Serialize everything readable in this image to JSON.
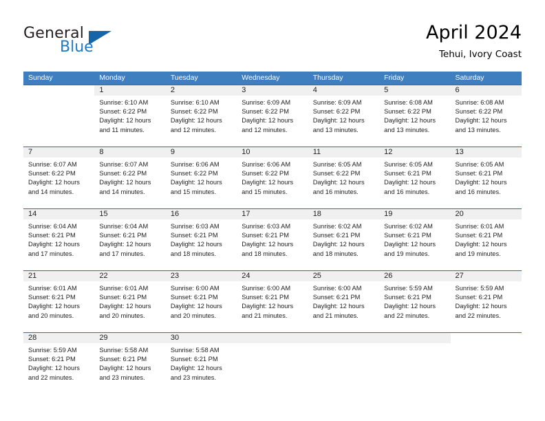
{
  "logo": {
    "word_top": "General",
    "word_bottom": "Blue",
    "triangle_color": "#1565a8",
    "blue_color": "#1f7ac4"
  },
  "header": {
    "title": "April 2024",
    "subtitle": "Tehui, Ivory Coast"
  },
  "theme": {
    "header_row_bg": "#3f7fbf",
    "row_divider": "#2e6da4",
    "day_band_bg": "#f0f0f0"
  },
  "weekdays": [
    "Sunday",
    "Monday",
    "Tuesday",
    "Wednesday",
    "Thursday",
    "Friday",
    "Saturday"
  ],
  "weeks": [
    {
      "days": [
        {
          "number": "",
          "sunrise": "",
          "sunset": "",
          "daylight_1": "",
          "daylight_2": "",
          "state": "blank"
        },
        {
          "number": "1",
          "sunrise": "Sunrise: 6:10 AM",
          "sunset": "Sunset: 6:22 PM",
          "daylight_1": "Daylight: 12 hours",
          "daylight_2": "and 11 minutes.",
          "state": "filled"
        },
        {
          "number": "2",
          "sunrise": "Sunrise: 6:10 AM",
          "sunset": "Sunset: 6:22 PM",
          "daylight_1": "Daylight: 12 hours",
          "daylight_2": "and 12 minutes.",
          "state": "filled"
        },
        {
          "number": "3",
          "sunrise": "Sunrise: 6:09 AM",
          "sunset": "Sunset: 6:22 PM",
          "daylight_1": "Daylight: 12 hours",
          "daylight_2": "and 12 minutes.",
          "state": "filled"
        },
        {
          "number": "4",
          "sunrise": "Sunrise: 6:09 AM",
          "sunset": "Sunset: 6:22 PM",
          "daylight_1": "Daylight: 12 hours",
          "daylight_2": "and 13 minutes.",
          "state": "filled"
        },
        {
          "number": "5",
          "sunrise": "Sunrise: 6:08 AM",
          "sunset": "Sunset: 6:22 PM",
          "daylight_1": "Daylight: 12 hours",
          "daylight_2": "and 13 minutes.",
          "state": "filled"
        },
        {
          "number": "6",
          "sunrise": "Sunrise: 6:08 AM",
          "sunset": "Sunset: 6:22 PM",
          "daylight_1": "Daylight: 12 hours",
          "daylight_2": "and 13 minutes.",
          "state": "filled"
        }
      ]
    },
    {
      "days": [
        {
          "number": "7",
          "sunrise": "Sunrise: 6:07 AM",
          "sunset": "Sunset: 6:22 PM",
          "daylight_1": "Daylight: 12 hours",
          "daylight_2": "and 14 minutes.",
          "state": "filled"
        },
        {
          "number": "8",
          "sunrise": "Sunrise: 6:07 AM",
          "sunset": "Sunset: 6:22 PM",
          "daylight_1": "Daylight: 12 hours",
          "daylight_2": "and 14 minutes.",
          "state": "filled"
        },
        {
          "number": "9",
          "sunrise": "Sunrise: 6:06 AM",
          "sunset": "Sunset: 6:22 PM",
          "daylight_1": "Daylight: 12 hours",
          "daylight_2": "and 15 minutes.",
          "state": "filled"
        },
        {
          "number": "10",
          "sunrise": "Sunrise: 6:06 AM",
          "sunset": "Sunset: 6:22 PM",
          "daylight_1": "Daylight: 12 hours",
          "daylight_2": "and 15 minutes.",
          "state": "filled"
        },
        {
          "number": "11",
          "sunrise": "Sunrise: 6:05 AM",
          "sunset": "Sunset: 6:22 PM",
          "daylight_1": "Daylight: 12 hours",
          "daylight_2": "and 16 minutes.",
          "state": "filled"
        },
        {
          "number": "12",
          "sunrise": "Sunrise: 6:05 AM",
          "sunset": "Sunset: 6:21 PM",
          "daylight_1": "Daylight: 12 hours",
          "daylight_2": "and 16 minutes.",
          "state": "filled"
        },
        {
          "number": "13",
          "sunrise": "Sunrise: 6:05 AM",
          "sunset": "Sunset: 6:21 PM",
          "daylight_1": "Daylight: 12 hours",
          "daylight_2": "and 16 minutes.",
          "state": "filled"
        }
      ]
    },
    {
      "days": [
        {
          "number": "14",
          "sunrise": "Sunrise: 6:04 AM",
          "sunset": "Sunset: 6:21 PM",
          "daylight_1": "Daylight: 12 hours",
          "daylight_2": "and 17 minutes.",
          "state": "filled"
        },
        {
          "number": "15",
          "sunrise": "Sunrise: 6:04 AM",
          "sunset": "Sunset: 6:21 PM",
          "daylight_1": "Daylight: 12 hours",
          "daylight_2": "and 17 minutes.",
          "state": "filled"
        },
        {
          "number": "16",
          "sunrise": "Sunrise: 6:03 AM",
          "sunset": "Sunset: 6:21 PM",
          "daylight_1": "Daylight: 12 hours",
          "daylight_2": "and 18 minutes.",
          "state": "filled"
        },
        {
          "number": "17",
          "sunrise": "Sunrise: 6:03 AM",
          "sunset": "Sunset: 6:21 PM",
          "daylight_1": "Daylight: 12 hours",
          "daylight_2": "and 18 minutes.",
          "state": "filled"
        },
        {
          "number": "18",
          "sunrise": "Sunrise: 6:02 AM",
          "sunset": "Sunset: 6:21 PM",
          "daylight_1": "Daylight: 12 hours",
          "daylight_2": "and 18 minutes.",
          "state": "filled"
        },
        {
          "number": "19",
          "sunrise": "Sunrise: 6:02 AM",
          "sunset": "Sunset: 6:21 PM",
          "daylight_1": "Daylight: 12 hours",
          "daylight_2": "and 19 minutes.",
          "state": "filled"
        },
        {
          "number": "20",
          "sunrise": "Sunrise: 6:01 AM",
          "sunset": "Sunset: 6:21 PM",
          "daylight_1": "Daylight: 12 hours",
          "daylight_2": "and 19 minutes.",
          "state": "filled"
        }
      ]
    },
    {
      "days": [
        {
          "number": "21",
          "sunrise": "Sunrise: 6:01 AM",
          "sunset": "Sunset: 6:21 PM",
          "daylight_1": "Daylight: 12 hours",
          "daylight_2": "and 20 minutes.",
          "state": "filled"
        },
        {
          "number": "22",
          "sunrise": "Sunrise: 6:01 AM",
          "sunset": "Sunset: 6:21 PM",
          "daylight_1": "Daylight: 12 hours",
          "daylight_2": "and 20 minutes.",
          "state": "filled"
        },
        {
          "number": "23",
          "sunrise": "Sunrise: 6:00 AM",
          "sunset": "Sunset: 6:21 PM",
          "daylight_1": "Daylight: 12 hours",
          "daylight_2": "and 20 minutes.",
          "state": "filled"
        },
        {
          "number": "24",
          "sunrise": "Sunrise: 6:00 AM",
          "sunset": "Sunset: 6:21 PM",
          "daylight_1": "Daylight: 12 hours",
          "daylight_2": "and 21 minutes.",
          "state": "filled"
        },
        {
          "number": "25",
          "sunrise": "Sunrise: 6:00 AM",
          "sunset": "Sunset: 6:21 PM",
          "daylight_1": "Daylight: 12 hours",
          "daylight_2": "and 21 minutes.",
          "state": "filled"
        },
        {
          "number": "26",
          "sunrise": "Sunrise: 5:59 AM",
          "sunset": "Sunset: 6:21 PM",
          "daylight_1": "Daylight: 12 hours",
          "daylight_2": "and 22 minutes.",
          "state": "filled"
        },
        {
          "number": "27",
          "sunrise": "Sunrise: 5:59 AM",
          "sunset": "Sunset: 6:21 PM",
          "daylight_1": "Daylight: 12 hours",
          "daylight_2": "and 22 minutes.",
          "state": "filled"
        }
      ]
    },
    {
      "days": [
        {
          "number": "28",
          "sunrise": "Sunrise: 5:59 AM",
          "sunset": "Sunset: 6:21 PM",
          "daylight_1": "Daylight: 12 hours",
          "daylight_2": "and 22 minutes.",
          "state": "filled"
        },
        {
          "number": "29",
          "sunrise": "Sunrise: 5:58 AM",
          "sunset": "Sunset: 6:21 PM",
          "daylight_1": "Daylight: 12 hours",
          "daylight_2": "and 23 minutes.",
          "state": "filled"
        },
        {
          "number": "30",
          "sunrise": "Sunrise: 5:58 AM",
          "sunset": "Sunset: 6:21 PM",
          "daylight_1": "Daylight: 12 hours",
          "daylight_2": "and 23 minutes.",
          "state": "filled"
        },
        {
          "number": "",
          "sunrise": "",
          "sunset": "",
          "daylight_1": "",
          "daylight_2": "",
          "state": "empty"
        },
        {
          "number": "",
          "sunrise": "",
          "sunset": "",
          "daylight_1": "",
          "daylight_2": "",
          "state": "empty"
        },
        {
          "number": "",
          "sunrise": "",
          "sunset": "",
          "daylight_1": "",
          "daylight_2": "",
          "state": "empty"
        },
        {
          "number": "",
          "sunrise": "",
          "sunset": "",
          "daylight_1": "",
          "daylight_2": "",
          "state": "blank"
        }
      ]
    }
  ]
}
